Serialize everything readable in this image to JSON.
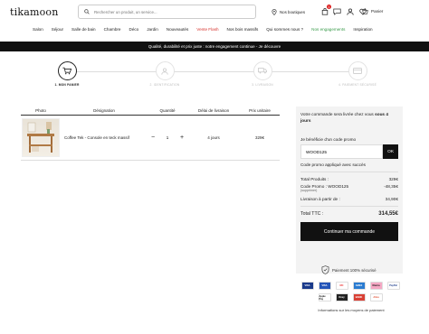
{
  "header": {
    "logo": "tikamoon",
    "search_placeholder": "Rechercher un produit, un service...",
    "stores_label": "Nos boutiques",
    "cart_badge": "1",
    "cart_label": "Panier"
  },
  "nav": {
    "items": [
      "Salon",
      "Séjour",
      "Salle de bain",
      "Chambre",
      "Déco",
      "Jardin",
      "Nouveautés",
      "Vente Flash",
      "Nos bois massifs",
      "Qui sommes nous ?",
      "Nos engagements",
      "Inspiration"
    ]
  },
  "banner": {
    "text": "Qualité, durabilité et prix juste : notre engagement continue - Je découvre"
  },
  "steps": [
    {
      "label": "1. MON PANIER"
    },
    {
      "label": "2. IDENTIFICATION"
    },
    {
      "label": "3. LIVRAISON"
    },
    {
      "label": "4. PAIEMENT SÉCURISÉ"
    }
  ],
  "table": {
    "headers": {
      "photo": "Photo",
      "designation": "Désignation",
      "quantity": "Quantité",
      "delay": "Délai de livraison",
      "unit_price": "Prix unitaire"
    },
    "rows": [
      {
        "designation": "Coffee Tek - Console en teck massif",
        "quantity": "1",
        "delay": "4 jours",
        "price": "329€"
      }
    ]
  },
  "summary": {
    "delivery_prefix": "Votre commande sera livrée chez vous",
    "delivery_days": "sous 4 jours",
    "promo_label": "Je bénéficie d'un code promo",
    "promo_code": "WOOD125",
    "ok_label": "OK",
    "applied_msg": "Code promo appliqué avec succès",
    "total_products_label": "Total Produits :",
    "total_products_value": "329€",
    "promo_line_label": "Code Promo : WOOD125",
    "promo_line_value": "-48,35€",
    "promo_remove": "(supprimer)",
    "shipping_label": "Livraison à partir de :",
    "shipping_value": "34,90€",
    "total_label": "Total TTC :",
    "total_value": "314,55€",
    "cta": "Continuer ma commande"
  },
  "secure_label": "Paiement 100% sécurisé",
  "payments": [
    "VISA",
    "VISA",
    "MC",
    "AMEX",
    "Klarna",
    "PayPal",
    "Apple Pay",
    "Oney",
    "BANK",
    "Alma"
  ],
  "payment_info": "Informations sur les moyens de paiement"
}
